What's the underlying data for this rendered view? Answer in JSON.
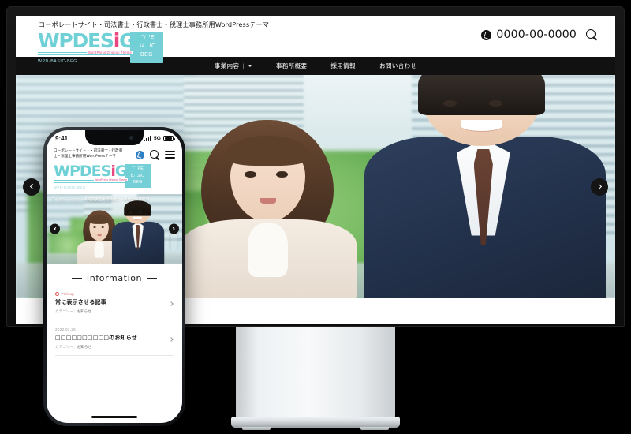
{
  "desktop": {
    "tagline": "コーポレートサイト・司法書士・行政書士・税理士事務所用WordPressテーマ",
    "logo": {
      "word_a": "WPDES",
      "word_i": "i",
      "word_b": "GN",
      "sub_left": "WPD-BASIC-BEG",
      "sub_right": "WordPress Original Theme"
    },
    "badge": {
      "line1": "TYPE",
      "line2": "BASIC",
      "line3": "BEG"
    },
    "header": {
      "phone_icon": "phone-icon",
      "phone_number": "0000-00-0000",
      "search_icon": "search-icon"
    },
    "nav": [
      {
        "label": "事業内容",
        "separator": "|",
        "has_dropdown": true
      },
      {
        "label": "事務所概要",
        "has_dropdown": false
      },
      {
        "label": "採用情報",
        "has_dropdown": false
      },
      {
        "label": "お問い合わせ",
        "has_dropdown": false
      }
    ],
    "carousel": {
      "prev_icon": "chevron-left-icon",
      "next_icon": "chevron-right-icon"
    }
  },
  "phone": {
    "statusbar": {
      "time": "9:41",
      "network": "5G",
      "signal_icon": "signal-bars-icon",
      "battery_icon": "battery-icon"
    },
    "tagline": "コーポレートサイト・・司法書士・行政書士・税理士事務所用WordPressテーマ",
    "icons": {
      "tel": "phone-icon",
      "search": "search-icon",
      "menu": "hamburger-menu-icon"
    },
    "logo": {
      "word_a": "WPDES",
      "word_i": "i",
      "word_b": "GN",
      "sub_left": "WPD-BASIC-BEG",
      "sub_right": "WordPress Original Theme"
    },
    "badge": {
      "line1": "TYPE",
      "line2": "BASIC",
      "line3": "BEG"
    },
    "hero_text": "コーポレートサイト・司法書士・行政書士・税理士事務所用",
    "carousel": {
      "prev_icon": "chevron-left-icon",
      "next_icon": "chevron-right-icon"
    },
    "information": {
      "heading": "Information",
      "items": [
        {
          "pickup_label": "Pick up",
          "date": "",
          "title": "常に表示させる記事",
          "category_label": "カテゴリー：",
          "category_value": "お知らせ",
          "chevron": "chevron-right-icon"
        },
        {
          "pickup_label": "",
          "date": "2022.02.26",
          "title": "□□□□□□□□□□のお知らせ",
          "category_label": "カテゴリー：",
          "category_value": "お知らせ",
          "chevron": "chevron-right-icon"
        }
      ]
    }
  },
  "colors": {
    "brand_teal": "#6fd0d6",
    "badge_teal": "#74cfd6",
    "accent_pink": "#e8487f",
    "nav_black": "#111111",
    "phone_accent_blue": "#2f7fc4",
    "pickup_red": "#d94a4a"
  }
}
